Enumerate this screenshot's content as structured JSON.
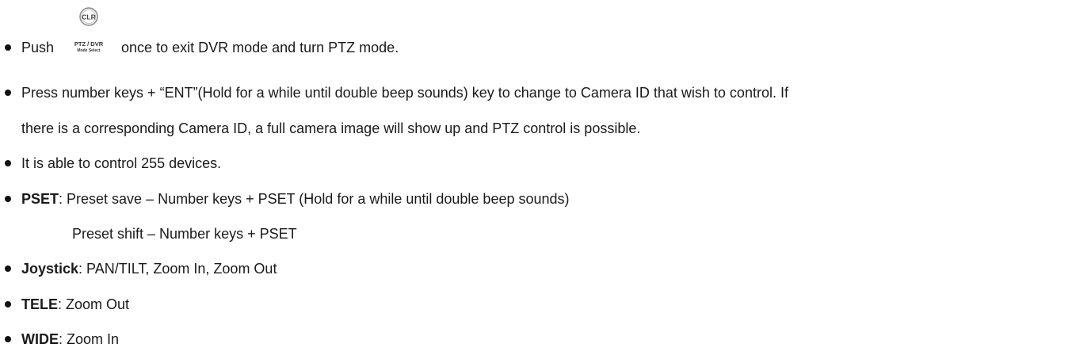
{
  "items": [
    {
      "pre": "Push",
      "post": "once to exit DVR mode and turn PTZ mode."
    },
    {
      "line1": "Press number keys + “ENT”(Hold for a while until double beep sounds) key to change to Camera ID that wish to control. If",
      "line2": "there is a corresponding Camera ID, a full camera image will show up and PTZ control is possible."
    },
    {
      "text": "It is able to control 255 devices."
    },
    {
      "label": "PSET",
      "text": ": Preset save – Number keys + PSET (Hold for a while until double beep sounds)",
      "line2": "Preset shift – Number keys + PSET"
    },
    {
      "label": "Joystick",
      "text": ": PAN/TILT, Zoom In, Zoom Out"
    },
    {
      "label": "TELE",
      "text": ": Zoom Out"
    },
    {
      "label": "WIDE",
      "text": ": Zoom In"
    }
  ],
  "key_icon": {
    "top_label": "CLR",
    "main_label": "PTZ / DVR",
    "sub_label": "Mode Select",
    "icon": "ptz-dvr-key-icon"
  }
}
